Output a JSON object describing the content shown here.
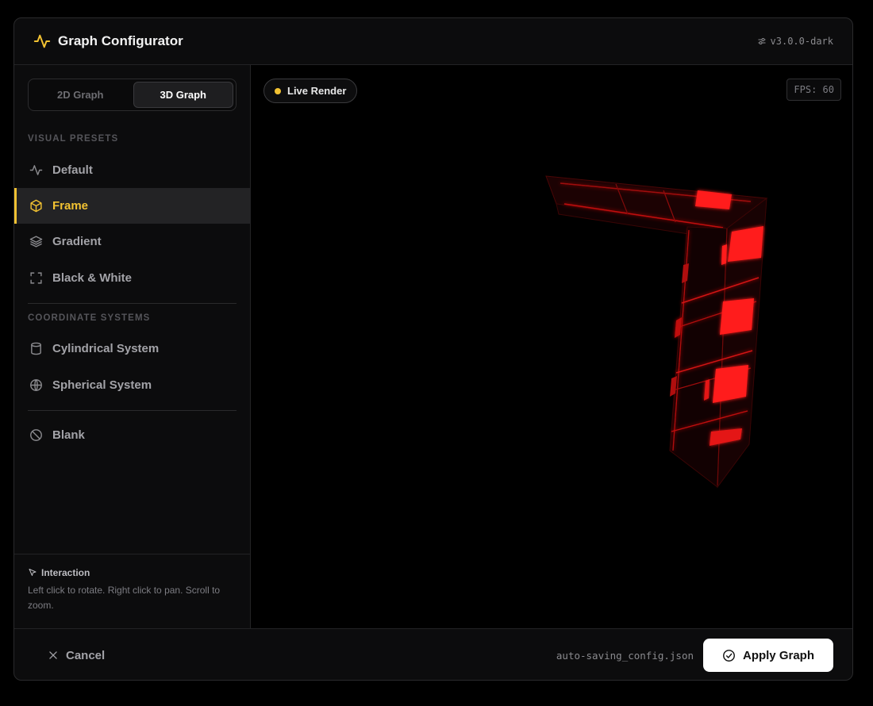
{
  "header": {
    "title": "Graph Configurator",
    "version": "v3.0.0-dark",
    "icon": "activity-icon"
  },
  "mode_toggle": {
    "options": [
      "2D Graph",
      "3D Graph"
    ],
    "selected": "3D Graph"
  },
  "sidebar": {
    "visual_presets_label": "VISUAL PRESETS",
    "visual_presets": [
      {
        "label": "Default",
        "icon": "activity-icon"
      },
      {
        "label": "Frame",
        "icon": "box-icon",
        "active": true
      },
      {
        "label": "Gradient",
        "icon": "layers-icon"
      },
      {
        "label": "Black & White",
        "icon": "scan-icon"
      }
    ],
    "coordinate_systems_label": "COORDINATE SYSTEMS",
    "coordinate_systems": [
      {
        "label": "Cylindrical System",
        "icon": "cylinder-icon"
      },
      {
        "label": "Spherical System",
        "icon": "globe-icon"
      }
    ],
    "other": [
      {
        "label": "Blank",
        "icon": "ban-icon"
      }
    ],
    "hint": {
      "title": "Interaction",
      "text": "Left click to rotate. Right click to pan. Scroll to zoom."
    }
  },
  "viewport": {
    "status": "Live Render",
    "fps": "FPS: 60"
  },
  "footer": {
    "cancel": "Cancel",
    "autosave": "auto-saving_config.json",
    "apply": "Apply Graph"
  },
  "colors": {
    "accent": "#f2c232",
    "frame_red": "#ff1a1a",
    "background": "#000000"
  }
}
